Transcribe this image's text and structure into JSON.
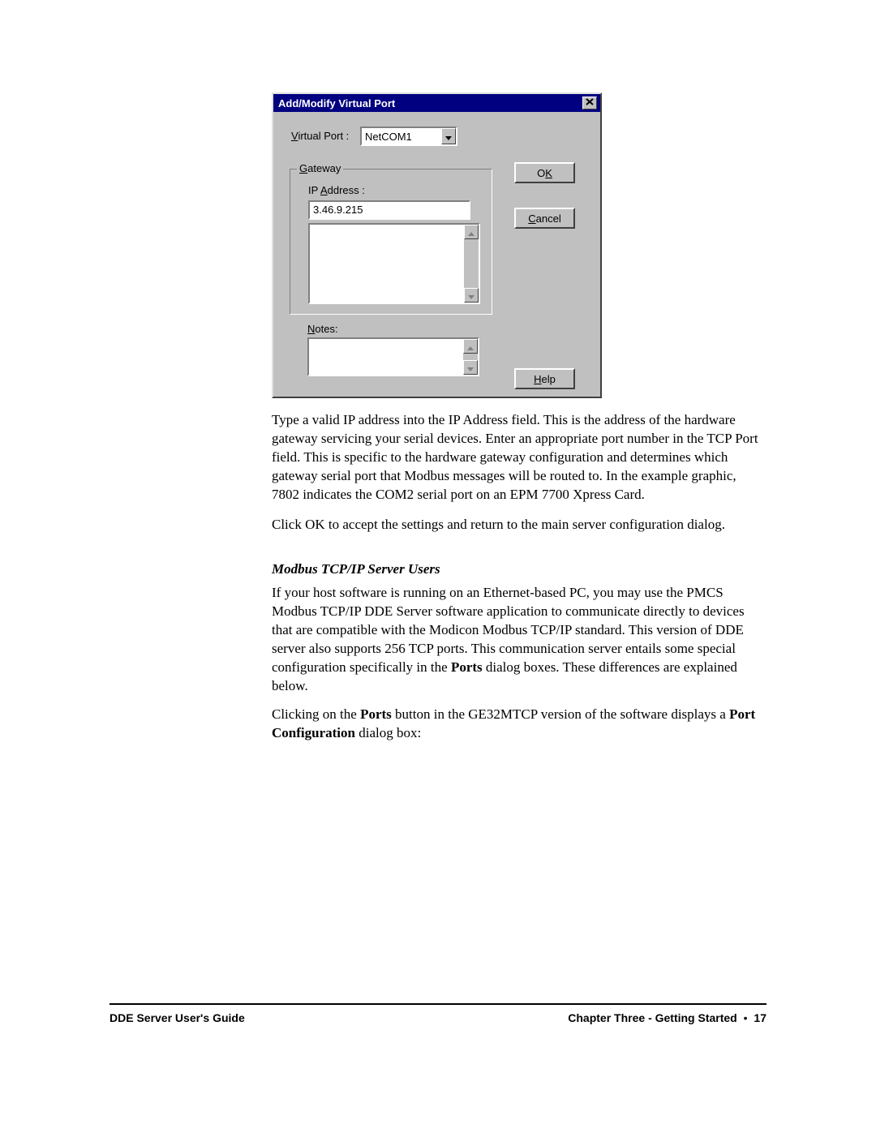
{
  "dialog": {
    "title": "Add/Modify Virtual Port",
    "virtual_port_label_pre": "V",
    "virtual_port_label_post": "irtual Port :",
    "virtual_port_value": "NetCOM1",
    "gateway_legend_pre": "G",
    "gateway_legend_post": "ateway",
    "ip_label_pre": "IP ",
    "ip_label_u": "A",
    "ip_label_post": "ddress :",
    "ip_value": "3.46.9.215",
    "notes_label_pre": "N",
    "notes_label_post": "otes:",
    "ok_pre": "O",
    "ok_u": "K",
    "cancel_u": "C",
    "cancel_post": "ancel",
    "help_u": "H",
    "help_post": "elp"
  },
  "body": {
    "p1": "Type a valid IP address into the IP Address field. This is the address of the hardware gateway servicing your serial devices. Enter an appropriate port number in the TCP Port field. This is specific to the hardware gateway configuration and determines which gateway serial port that Modbus messages will be routed to. In the example graphic, 7802 indicates the COM2 serial port on an EPM 7700 Xpress Card.",
    "p2": "Click OK to accept the settings and return to the main server configuration dialog.",
    "h1": "Modbus TCP/IP Server Users",
    "p3_a": "If your host software is running on an Ethernet-based PC, you may use the PMCS Modbus TCP/IP DDE Server software application to communicate directly to devices that are compatible with the Modicon Modbus TCP/IP standard. This version of DDE server also supports 256 TCP ports. This communication server entails some special configuration specifically in the ",
    "p3_b": "Ports",
    "p3_c": " dialog boxes. These differences are explained below.",
    "p4_a": "Clicking on the ",
    "p4_b": "Ports",
    "p4_c": " button in the GE32MTCP version of the software displays a ",
    "p4_d": "Port Configuration",
    "p4_e": " dialog box:"
  },
  "footer": {
    "left": "DDE Server User's Guide",
    "chapter": "Chapter Three - Getting Started",
    "page": "17"
  }
}
